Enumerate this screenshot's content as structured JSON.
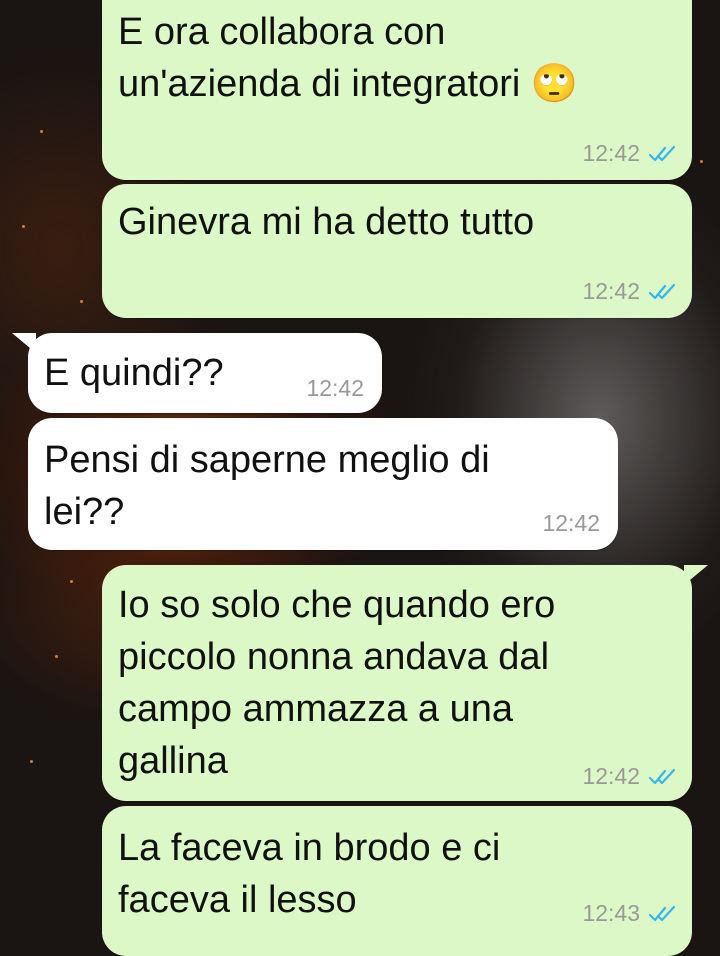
{
  "messages": [
    {
      "direction": "outgoing",
      "text": "E ora collabora con\nun'azienda di integratori 🙄",
      "time": "12:42",
      "status": "read"
    },
    {
      "direction": "outgoing",
      "text": "Ginevra mi ha detto tutto",
      "time": "12:42",
      "status": "read"
    },
    {
      "direction": "incoming",
      "text": "E quindi??",
      "time": "12:42"
    },
    {
      "direction": "incoming",
      "text": "Pensi di saperne meglio di\nlei??",
      "time": "12:42"
    },
    {
      "direction": "outgoing",
      "text": "Io so solo che quando ero\npiccolo nonna andava dal\ncampo ammazza a una\ngallina",
      "time": "12:42",
      "status": "read"
    },
    {
      "direction": "outgoing",
      "text": "La faceva in brodo e ci\nfaceva il lesso",
      "time": "12:43",
      "status": "read"
    }
  ],
  "colors": {
    "outgoing_bubble": "#dcf8c6",
    "incoming_bubble": "#ffffff",
    "read_ticks": "#34b7f1",
    "timestamp": "#999999"
  },
  "icons": {
    "read_receipt": "double-check-icon"
  }
}
